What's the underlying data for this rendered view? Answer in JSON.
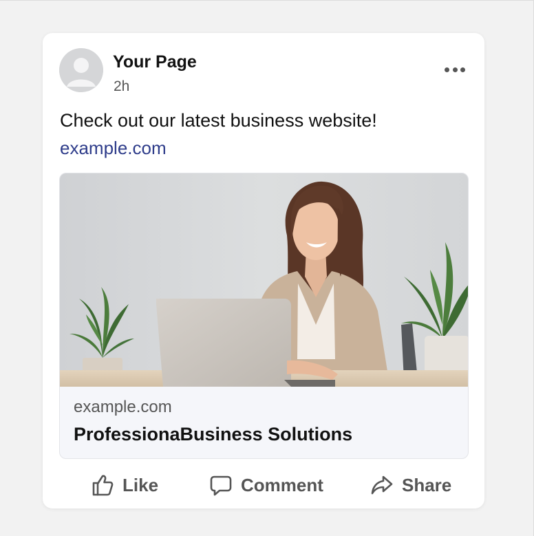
{
  "post": {
    "author": "Your Page",
    "time": "2h",
    "text": "Check out our latest business website!",
    "link": "example.com"
  },
  "preview": {
    "domain": "example.com",
    "title": "ProfessionaBusiness Solutions",
    "image_icon": "woman-with-laptop-photo"
  },
  "actions": {
    "like": "Like",
    "comment": "Comment",
    "share": "Share"
  },
  "icons": {
    "avatar": "avatar-placeholder-icon",
    "more": "more-horizontal-icon",
    "like": "thumbs-up-icon",
    "comment": "speech-bubble-icon",
    "share": "share-arrow-icon"
  },
  "colors": {
    "background": "#f2f2f2",
    "card": "#ffffff",
    "link": "#2e3c8a",
    "action_text": "#555555"
  }
}
